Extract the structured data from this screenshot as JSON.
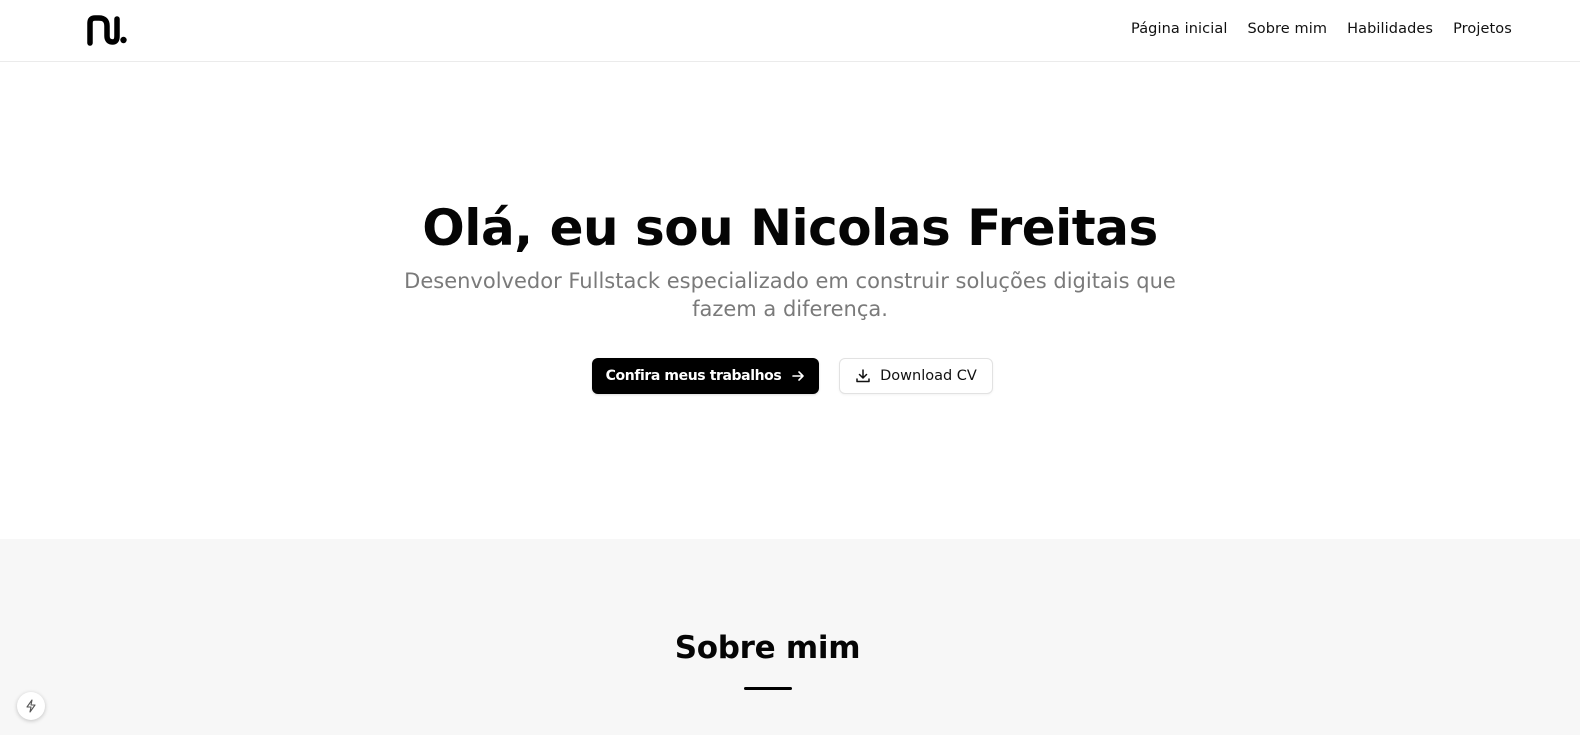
{
  "header": {
    "logo_icon": "brand-logo-nu",
    "nav": [
      {
        "label": "Página inicial"
      },
      {
        "label": "Sobre mim"
      },
      {
        "label": "Habilidades"
      },
      {
        "label": "Projetos"
      }
    ]
  },
  "hero": {
    "title": "Olá, eu sou Nicolas Freitas",
    "subtitle_line1": "Desenvolvedor Fullstack especializado em construir soluções digitais que",
    "subtitle_line2": "fazem a diferença.",
    "primary_button": {
      "label": "Confira meus trabalhos",
      "icon": "arrow-right-icon"
    },
    "secondary_button": {
      "label": "Download CV",
      "icon": "download-icon"
    }
  },
  "about": {
    "title": "Sobre mim"
  },
  "floating": {
    "icon": "lightning-icon"
  },
  "colors": {
    "primary": "#000000",
    "background": "#ffffff",
    "section_alt": "#f7f7f7",
    "muted_text": "#7a7a7a"
  }
}
